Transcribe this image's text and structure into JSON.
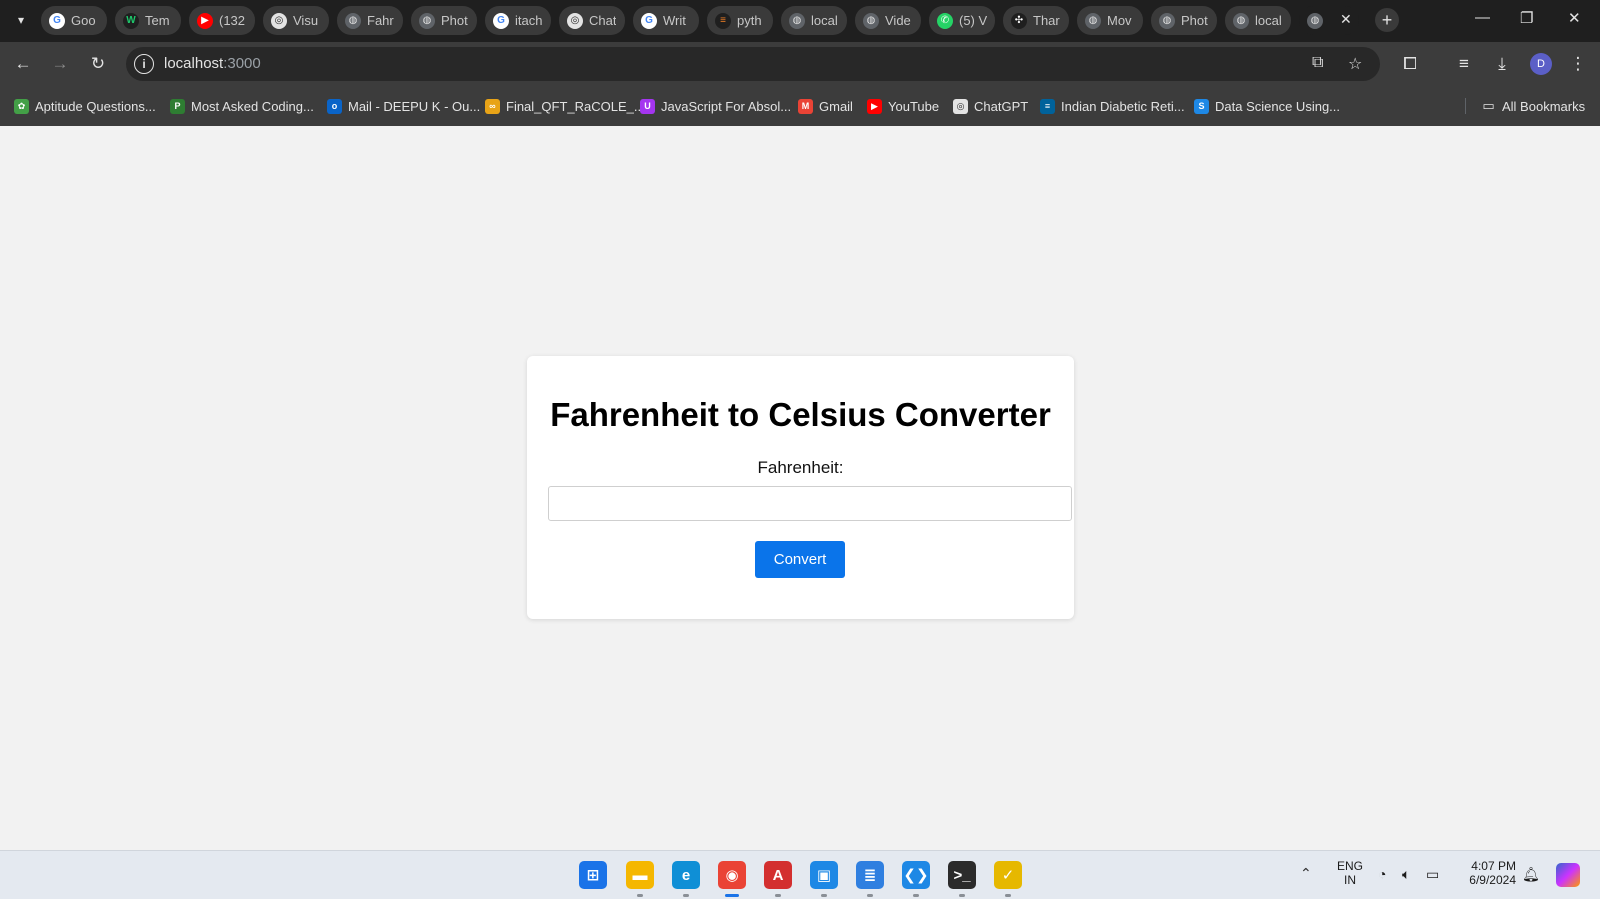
{
  "browser": {
    "tabs": [
      {
        "title": "Goo",
        "icon": "google-icon",
        "color": "#ffffff",
        "glyph": "G",
        "text": "#4285f4"
      },
      {
        "title": "Tem",
        "icon": "wix-icon",
        "color": "#1f1f1f",
        "glyph": "W",
        "text": "#1ec86c"
      },
      {
        "title": "(132",
        "icon": "youtube-icon",
        "color": "#ff0000",
        "glyph": "▶",
        "text": "#ffffff"
      },
      {
        "title": "Visu",
        "icon": "openai-icon",
        "color": "#e3e3e3",
        "glyph": "◎",
        "text": "#1f1f1f"
      },
      {
        "title": "Fahr",
        "icon": "globe-icon",
        "color": "#5f6368",
        "glyph": "◍",
        "text": "#e3e3e3"
      },
      {
        "title": "Phot",
        "icon": "globe-icon",
        "color": "#5f6368",
        "glyph": "◍",
        "text": "#e3e3e3"
      },
      {
        "title": "itach",
        "icon": "google-icon",
        "color": "#ffffff",
        "glyph": "G",
        "text": "#4285f4"
      },
      {
        "title": "Chat",
        "icon": "openai-icon",
        "color": "#e3e3e3",
        "glyph": "◎",
        "text": "#1f1f1f"
      },
      {
        "title": "Writ",
        "icon": "google-icon",
        "color": "#ffffff",
        "glyph": "G",
        "text": "#4285f4"
      },
      {
        "title": "pyth",
        "icon": "stackoverflow-icon",
        "color": "#1f1f1f",
        "glyph": "≡",
        "text": "#f48024"
      },
      {
        "title": "local",
        "icon": "globe-icon",
        "color": "#5f6368",
        "glyph": "◍",
        "text": "#e3e3e3"
      },
      {
        "title": "Vide",
        "icon": "globe-icon",
        "color": "#5f6368",
        "glyph": "◍",
        "text": "#e3e3e3"
      },
      {
        "title": "(5) V",
        "icon": "whatsapp-icon",
        "color": "#25d366",
        "glyph": "✆",
        "text": "#ffffff"
      },
      {
        "title": "Thar",
        "icon": "dots-icon",
        "color": "#1f1f1f",
        "glyph": "✣",
        "text": "#ffffff"
      },
      {
        "title": "Mov",
        "icon": "globe-icon",
        "color": "#5f6368",
        "glyph": "◍",
        "text": "#e3e3e3"
      },
      {
        "title": "Phot",
        "icon": "globe-icon",
        "color": "#5f6368",
        "glyph": "◍",
        "text": "#e3e3e3"
      },
      {
        "title": "local",
        "icon": "globe-icon",
        "color": "#5f6368",
        "glyph": "◍",
        "text": "#e3e3e3"
      },
      {
        "title": "",
        "icon": "globe-icon",
        "color": "#5f6368",
        "glyph": "◍",
        "text": "#e3e3e3",
        "active": true
      }
    ],
    "tab_close": "✕",
    "new_tab": "+",
    "url_host": "localhost",
    "url_port": ":3000",
    "profile_initial": "D",
    "bookmarks": [
      {
        "label": "Aptitude Questions...",
        "icon": "aptitude-icon",
        "color": "#43a047",
        "glyph": "✿"
      },
      {
        "label": "Most Asked Coding...",
        "icon": "coding-icon",
        "color": "#2e7d32",
        "glyph": "P"
      },
      {
        "label": "Mail - DEEPU K - Ou...",
        "icon": "outlook-icon",
        "color": "#0a64c8",
        "glyph": "o"
      },
      {
        "label": "Final_QFT_RaCOLE_...",
        "icon": "link-icon",
        "color": "#e8a317",
        "glyph": "∞"
      },
      {
        "label": "JavaScript For Absol...",
        "icon": "udemy-icon",
        "color": "#a435f0",
        "glyph": "U"
      },
      {
        "label": "Gmail",
        "icon": "gmail-icon",
        "color": "#ea4335",
        "glyph": "M"
      },
      {
        "label": "YouTube",
        "icon": "youtube-icon",
        "color": "#ff0000",
        "glyph": "▶"
      },
      {
        "label": "ChatGPT",
        "icon": "openai-icon",
        "color": "#e3e3e3",
        "glyph": "◎"
      },
      {
        "label": "Indian Diabetic Reti...",
        "icon": "ieee-icon",
        "color": "#00629b",
        "glyph": "≡"
      },
      {
        "label": "Data Science Using...",
        "icon": "s-icon",
        "color": "#1e88e5",
        "glyph": "S"
      }
    ],
    "all_bookmarks": "All Bookmarks"
  },
  "page": {
    "title": "Fahrenheit to Celsius Converter",
    "input_label": "Fahrenheit:",
    "input_value": "",
    "button_label": "Convert"
  },
  "taskbar": {
    "apps": [
      {
        "name": "windows-start-icon",
        "color": "#1a73e8",
        "glyph": "⊞"
      },
      {
        "name": "file-explorer-icon",
        "color": "#f5b700",
        "glyph": "▬"
      },
      {
        "name": "edge-icon",
        "color": "#0f8fd6",
        "glyph": "e"
      },
      {
        "name": "chrome-icon",
        "color": "#ea4335",
        "glyph": "◉"
      },
      {
        "name": "acrobat-icon",
        "color": "#d32f2f",
        "glyph": "A"
      },
      {
        "name": "photos-icon",
        "color": "#1e88e5",
        "glyph": "▣"
      },
      {
        "name": "notepad-icon",
        "color": "#2f7fe0",
        "glyph": "≣"
      },
      {
        "name": "vscode-icon",
        "color": "#1e88e5",
        "glyph": "❮❯"
      },
      {
        "name": "terminal-icon",
        "color": "#2b2b2b",
        "glyph": ">_"
      },
      {
        "name": "norton-icon",
        "color": "#e6b800",
        "glyph": "✓"
      }
    ],
    "lang_top": "ENG",
    "lang_bottom": "IN",
    "time": "4:07 PM",
    "date": "6/9/2024"
  }
}
